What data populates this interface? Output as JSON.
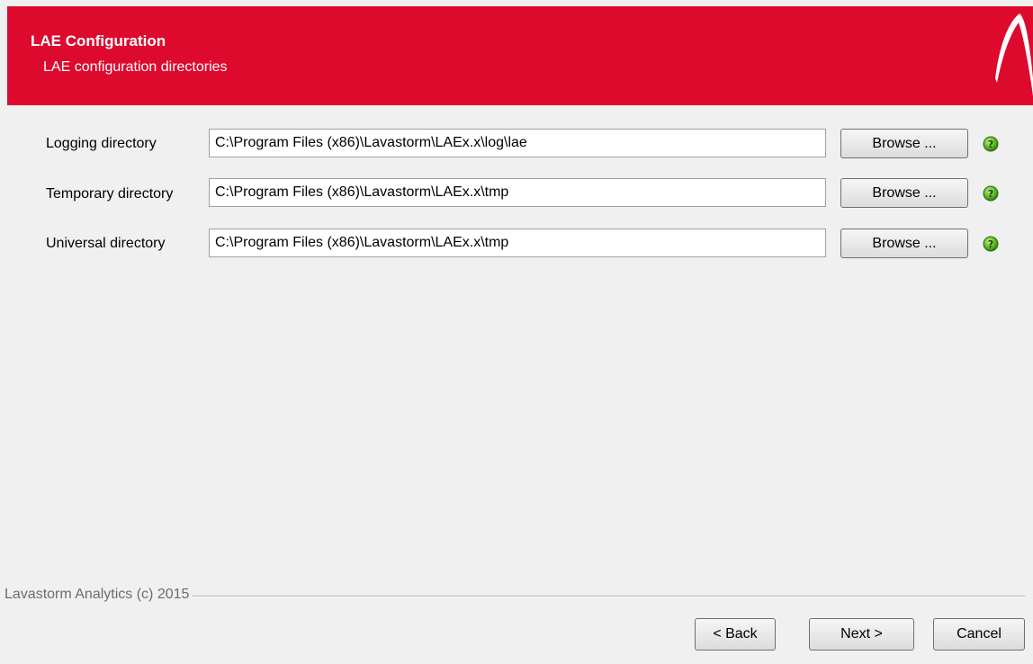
{
  "header": {
    "title": "LAE Configuration",
    "subtitle": "LAE configuration directories",
    "background_color": "#dd0a2e",
    "logo_icon": "lavastorm-arc-logo"
  },
  "rows": [
    {
      "label": "Logging directory",
      "value": "C:\\Program Files (x86)\\Lavastorm\\LAEx.x\\log\\lae",
      "browse_label": "Browse ...",
      "help_icon": "help-icon"
    },
    {
      "label": "Temporary directory",
      "value": "C:\\Program Files (x86)\\Lavastorm\\LAEx.x\\tmp",
      "browse_label": "Browse ...",
      "help_icon": "help-icon"
    },
    {
      "label": "Universal directory",
      "value": "C:\\Program Files (x86)\\Lavastorm\\LAEx.x\\tmp",
      "browse_label": "Browse ...",
      "help_icon": "help-icon"
    }
  ],
  "footer": {
    "copyright": "Lavastorm Analytics (c) 2015",
    "back_label": "< Back",
    "next_label": "Next >",
    "cancel_label": "Cancel"
  }
}
